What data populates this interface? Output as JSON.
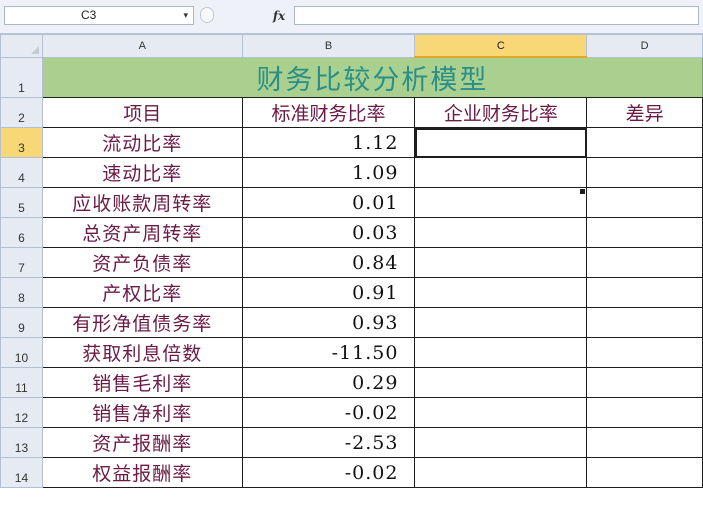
{
  "formula_bar": {
    "name_box": "C3",
    "name_box_arrow": "▾",
    "fx_label": "fx",
    "formula": ""
  },
  "columns": [
    "A",
    "B",
    "C",
    "D"
  ],
  "rows": [
    "1",
    "2",
    "3",
    "4",
    "5",
    "6",
    "7",
    "8",
    "9",
    "10",
    "11",
    "12",
    "13",
    "14"
  ],
  "sheet": {
    "title": "财务比较分析模型",
    "headers": [
      "项目",
      "标准财务比率",
      "企业财务比率",
      "差异"
    ],
    "items": [
      {
        "name": "流动比率",
        "standard": "1.12"
      },
      {
        "name": "速动比率",
        "standard": "1.09"
      },
      {
        "name": "应收账款周转率",
        "standard": "0.01"
      },
      {
        "name": "总资产周转率",
        "standard": "0.03"
      },
      {
        "name": "资产负债率",
        "standard": "0.84"
      },
      {
        "name": "产权比率",
        "standard": "0.91"
      },
      {
        "name": "有形净值债务率",
        "standard": "0.93"
      },
      {
        "name": "获取利息倍数",
        "standard": "-11.50"
      },
      {
        "name": "销售毛利率",
        "standard": "0.29"
      },
      {
        "name": "销售净利率",
        "standard": "-0.02"
      },
      {
        "name": "资产报酬率",
        "standard": "-2.53"
      },
      {
        "name": "权益报酬率",
        "standard": "-0.02"
      }
    ]
  },
  "selection": {
    "cell": "C3",
    "active_column": "C",
    "active_row": "3"
  },
  "colors": {
    "title_fill": "#a9d08e",
    "title_text": "#2a8f88",
    "label_text": "#6b1a45",
    "active_header": "#f7d776"
  }
}
